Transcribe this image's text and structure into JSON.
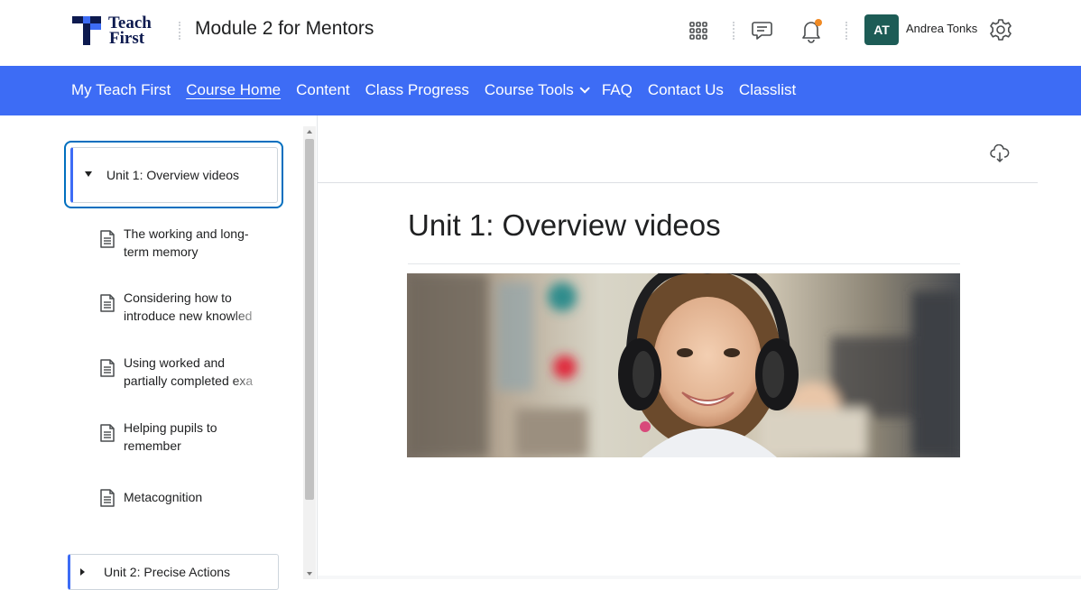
{
  "header": {
    "logo_line1": "Teach",
    "logo_line2": "First",
    "course_title": "Module 2 for Mentors",
    "user_initials": "AT",
    "user_name": "Andrea Tonks",
    "icons": [
      "apps-grid-icon",
      "chat-icon",
      "bell-icon",
      "gear-icon"
    ],
    "notification_dot_color": "#f08a24",
    "avatar_color": "#1d5c56"
  },
  "nav": {
    "background": "#3d6cf5",
    "items": [
      {
        "label": "My Teach First"
      },
      {
        "label": "Course Home"
      },
      {
        "label": "Content"
      },
      {
        "label": "Class Progress"
      },
      {
        "label": "Course Tools"
      },
      {
        "label": "FAQ"
      },
      {
        "label": "Contact Us"
      },
      {
        "label": "Classlist"
      }
    ],
    "active": "Course Home"
  },
  "sidebar": {
    "units": [
      {
        "label": "Unit 1: Overview videos",
        "expanded": true,
        "topics": [
          {
            "line1": "The working and long-",
            "line2": "term memory"
          },
          {
            "line1": "Considering how to",
            "line2": "introduce new knowled"
          },
          {
            "line1": "Using worked and",
            "line2": "partially completed exa"
          },
          {
            "line1": "Helping pupils to",
            "line2": "remember"
          },
          {
            "line1": "Metacognition",
            "line2": ""
          }
        ]
      },
      {
        "label": "Unit 2: Precise Actions",
        "expanded": false
      }
    ]
  },
  "main": {
    "page_title": "Unit 1: Overview videos",
    "hero_image": "child-with-headphones-image"
  }
}
